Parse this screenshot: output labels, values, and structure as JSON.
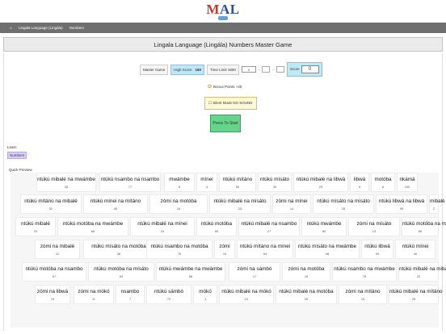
{
  "logo": {
    "m": "M",
    "rest": "AL"
  },
  "nav": {
    "item1": "Lingala Language (Lingála)",
    "item2": "Numbers"
  },
  "title": "Lingala Language (Lingála) Numbers Master Game",
  "controls": {
    "master_game": "Master Game",
    "high_score_label": "High Score",
    "high_score_value": "160",
    "time_limit_label": "Time Limit 1800",
    "time_value": "0",
    "separator": "-",
    "score_label": "Score",
    "score_value": "0"
  },
  "bonus": "Bonus Points +20",
  "silent_mode": "☐ Silent Mode NO SOUND",
  "start_button": "Press To Start",
  "learn_label": "Learn",
  "learn_button": "Numbers",
  "preview_label": "Quick Preview",
  "colors": {
    "navbar": "#6f6f6f",
    "start_button": "#66d48a",
    "high_score_bg": "#bfe8f5"
  },
  "cards": [
    {
      "word": "ntúkú mibalé na mwámbe",
      "num": "28"
    },
    {
      "word": "ntúkú nsambo na nsambo",
      "num": "77"
    },
    {
      "word": "mwámbe",
      "num": "8"
    },
    {
      "word": "mínei",
      "num": "4"
    },
    {
      "word": "ntúkú mítáno",
      "num": "50"
    },
    {
      "word": "ntúkú mísáto",
      "num": "30"
    },
    {
      "word": "ntúkú mibalé na libwá",
      "num": "29"
    },
    {
      "word": "libwá",
      "num": "9"
    },
    {
      "word": "motóba",
      "num": "6"
    },
    {
      "word": "nkámá",
      "num": "100"
    },
    {
      "word": "ntúkú mítáno na mibalé",
      "num": "52"
    },
    {
      "word": "ntúkú mínei na mítáno",
      "num": "45"
    },
    {
      "word": "zómi na motóba",
      "num": "16"
    },
    {
      "word": "ntúkú mibalé na mísáto",
      "num": "23"
    },
    {
      "word": "zómi na mínei",
      "num": "14"
    },
    {
      "word": "ntúkú mísáto na mísáto",
      "num": "33"
    },
    {
      "word": "ntúkú libwá na libwá",
      "num": "99"
    },
    {
      "word": "mibalé",
      "num": "2"
    },
    {
      "word": "ntúkú mibalé",
      "num": "20"
    },
    {
      "word": "ntúkú motóba na mwámbe",
      "num": "68"
    },
    {
      "word": "ntúkú mibalé na mínei",
      "num": "24"
    },
    {
      "word": "ntúkú motóba",
      "num": "60"
    },
    {
      "word": "ntúkú mibalé na nsambo",
      "num": "27"
    },
    {
      "word": "ntúkú mwámbe",
      "num": "80"
    },
    {
      "word": "zómi na mísáto",
      "num": "13"
    },
    {
      "word": "ntúkú motóba na motóba",
      "num": "66"
    },
    {
      "word": "zómi na mibalé",
      "num": "12"
    },
    {
      "word": "ntúkú mísáto na motóba",
      "num": "36"
    },
    {
      "word": "ntúkú nsambo na motóba",
      "num": "76"
    },
    {
      "word": "zómi",
      "num": "10"
    },
    {
      "word": "ntúkú mítáno na mínei",
      "num": "54"
    },
    {
      "word": "ntúkú mísáto na mwámbe",
      "num": "38"
    },
    {
      "word": "ntúkú libwá",
      "num": "90"
    },
    {
      "word": "ntúkú mínei",
      "num": "40"
    },
    {
      "word": "ntúkú motóba na nsambo",
      "num": "67"
    },
    {
      "word": "ntúkú motóba na mísáto",
      "num": "63"
    },
    {
      "word": "ntúkú mwámbe na mwámbe",
      "num": "88"
    },
    {
      "word": "zómi na sámbó",
      "num": "17"
    },
    {
      "word": "zómi na motóba",
      "num": "16"
    },
    {
      "word": "ntúkú nsambo na mwámbe",
      "num": "78"
    },
    {
      "word": "ntúkú mibalé na mibalé",
      "num": "22"
    },
    {
      "word": "zómi na libwá",
      "num": "19"
    },
    {
      "word": "zómi na mókó",
      "num": "11"
    },
    {
      "word": "nsambo",
      "num": "7"
    },
    {
      "word": "ntúkú sámbó",
      "num": "70"
    },
    {
      "word": "mókó",
      "num": "1"
    },
    {
      "word": "ntúkú mibalé na mókó",
      "num": "21"
    },
    {
      "word": "ntúkú mibalé na motóba",
      "num": "26"
    },
    {
      "word": "zómi na mítáno",
      "num": "15"
    },
    {
      "word": "ntúkú mibalé na mítáno",
      "num": "25"
    }
  ]
}
